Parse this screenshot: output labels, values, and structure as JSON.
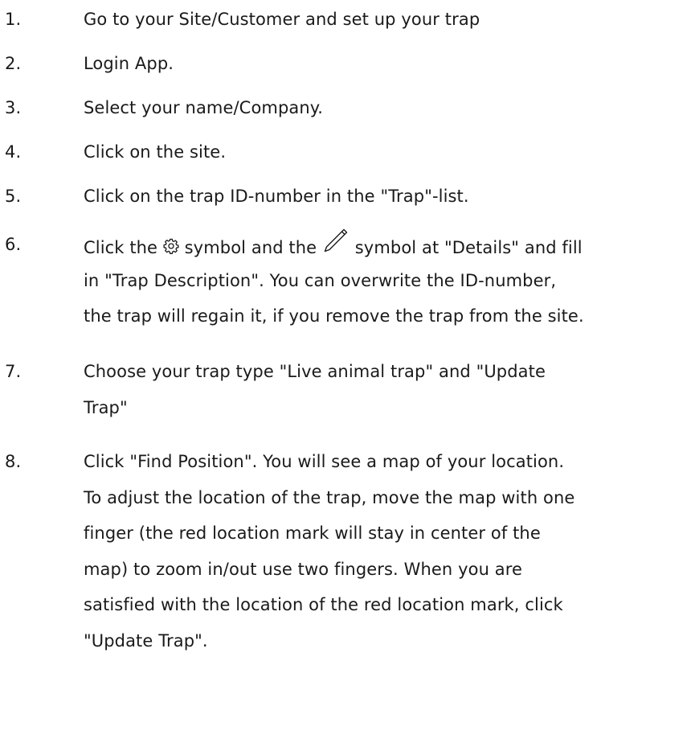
{
  "steps": [
    {
      "num": "1.",
      "lines": [
        "Go to your Site/Customer and set up your trap"
      ]
    },
    {
      "num": "2.",
      "lines": [
        "Login App."
      ]
    },
    {
      "num": "3.",
      "lines": [
        "Select your name/Company."
      ]
    },
    {
      "num": "4.",
      "lines": [
        "Click on the site."
      ]
    },
    {
      "num": "5.",
      "lines": [
        "Click on the trap ID-number in the \"Trap\"-list."
      ]
    },
    {
      "num": "6.",
      "line1": {
        "a": "Click the ",
        "icon1": "gear-icon",
        "b": " symbol and the ",
        "icon2": "pencil-icon",
        "c": " symbol at \"Details\" and fill"
      },
      "lines": [
        "in \"Trap Description\". You can overwrite the ID-number,",
        "the trap will regain it, if you remove the trap from the site."
      ]
    },
    {
      "num": "7.",
      "lines": [
        "Choose your trap type \"Live animal trap\" and \"Update",
        "Trap\""
      ]
    },
    {
      "num": "8.",
      "lines": [
        "Click \"Find Position\". You will see a map of your location.",
        "To adjust the location of the trap, move the map with one",
        "finger (the red location mark will stay in center of the",
        "map) to zoom in/out use two fingers. When you are",
        "satisfied with the location of the red location mark, click",
        "\"Update Trap\"."
      ]
    }
  ]
}
